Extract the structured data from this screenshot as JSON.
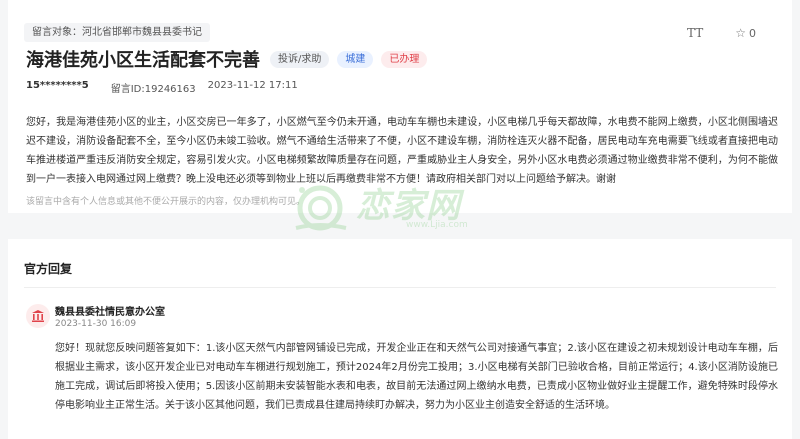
{
  "message": {
    "target_label": "留言对象：河北省邯郸市魏县县委书记",
    "title": "海港佳苑小区生活配套不完善",
    "tags": {
      "category": "投诉/求助",
      "field": "城建",
      "status": "已办理"
    },
    "user": "15********5",
    "message_id": "留言ID:19246163",
    "datetime": "2023-11-12 17:11",
    "body": "您好，我是海港佳苑小区的业主，小区交房已一年多了，小区燃气至今仍未开通，电动车车棚也未建设，小区电梯几乎每天都故障，水电费不能网上缴费，小区北侧围墙迟迟不建设，消防设备配套不全，至今小区仍未竣工验收。燃气不通给生活带来了不便，小区不建设车棚，消防栓连灭火器不配备，居民电动车充电需要飞线或者直接把电动车推进楼道严重违反消防安全规定，容易引发火灾。小区电梯频繁故障质量存在问题，严重威胁业主人身安全，另外小区水电费必须通过物业缴费非常不便利，为何不能做到一户一表接入电网通过网上缴费？晚上没电还必须等到物业上班以后再缴费非常不方便！请政府相关部门对以上问题给予解决。谢谢",
    "disclaimer": "该留言中含有个人信息或其他不便公开展示的内容，仅办理机构可见。",
    "likes": "0"
  },
  "toolbar": {
    "font_icon": "TT",
    "star_icon": "☆"
  },
  "watermark": {
    "text": "恋家网",
    "sub": "www.Ljia.com"
  },
  "reply": {
    "section_title": "官方回复",
    "department": "魏县县委社情民意办公室",
    "datetime": "2023-11-30 16:09",
    "body": "您好！现就您反映问题答复如下：1.该小区天然气内部管网铺设已完成，开发企业正在和天然气公司对接通气事宜；2.该小区在建设之初未规划设计电动车车棚，后根据业主需求，该小区开发企业已对电动车车棚进行规划施工，预计2024年2月份完工投用；3.小区电梯有关部门已验收合格，目前正常运行；4.该小区消防设施已施工完成，调试后即将投入使用；5.因该小区前期未安装智能水表和电表，故目前无法通过网上缴纳水电费，已责成小区物业做好业主提醒工作，避免特殊时段停水停电影响业主正常生活。关于该小区其他问题，我们已责成县住建局持续盯办解决，努力为小区业主创造安全舒适的生活环境。"
  },
  "colors": {
    "status_red": "#e0424a",
    "field_blue": "#3b6fd8"
  }
}
